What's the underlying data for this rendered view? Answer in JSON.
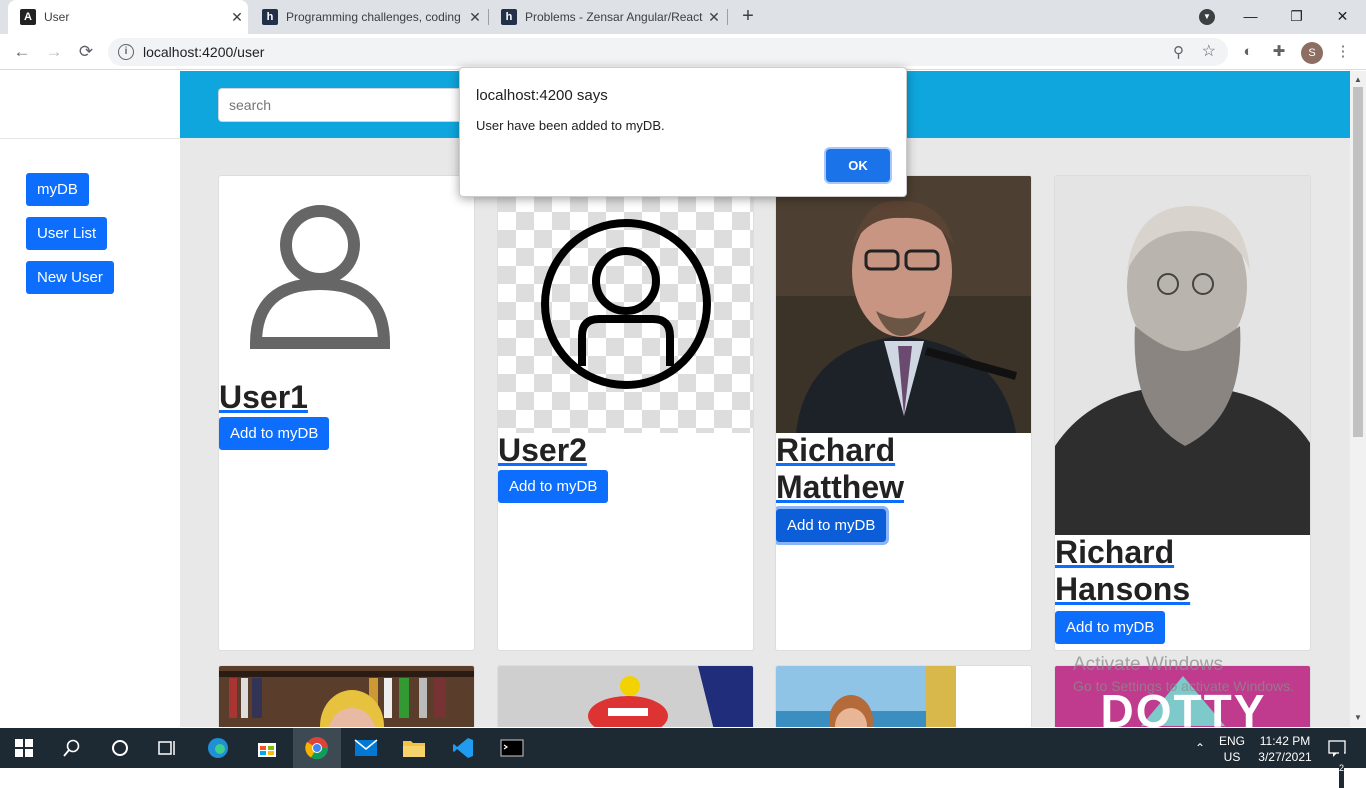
{
  "browser": {
    "tabs": [
      {
        "title": "User",
        "favicon": "angular-icon",
        "active": true
      },
      {
        "title": "Programming challenges, coding",
        "favicon": "hackerrank-icon",
        "active": false
      },
      {
        "title": "Problems - Zensar Angular/React",
        "favicon": "hackerrank-icon",
        "active": false
      }
    ],
    "new_tab": "+",
    "minimize": "—",
    "maximize": "❐",
    "close": "✕",
    "url": "localhost:4200/user",
    "profile_initial": "S"
  },
  "page": {
    "search_placeholder": "search",
    "sidebar": [
      "myDB",
      "User List",
      "New User"
    ],
    "add_label": "Add to myDB",
    "cards": [
      {
        "name": "User1",
        "image": "outline-person-icon"
      },
      {
        "name": "User2",
        "image": "circle-person-icon"
      },
      {
        "name": "Richard Matthew",
        "image": "photo-man-glasses"
      },
      {
        "name": "Richard Hansons",
        "image": "photo-old-man-beard"
      }
    ],
    "bottom_cards": [
      "photo-woman-bookshelf",
      "photo-skier",
      "photo-woman-beach",
      "dotty-poster"
    ],
    "poster_text": "DOTTY"
  },
  "dialog": {
    "title": "localhost:4200 says",
    "message": "User have been added to myDB.",
    "ok": "OK"
  },
  "watermark": {
    "line1": "Activate Windows",
    "line2": "Go to Settings to activate Windows."
  },
  "taskbar": {
    "lang1": "ENG",
    "lang2": "US",
    "time": "11:42 PM",
    "date": "3/27/2021",
    "notifications": "2"
  },
  "colors": {
    "accent": "#0d6efd",
    "header": "#0ea6dd",
    "content_bg": "#e8e8e8",
    "dialog_ok": "#1a73e8"
  }
}
